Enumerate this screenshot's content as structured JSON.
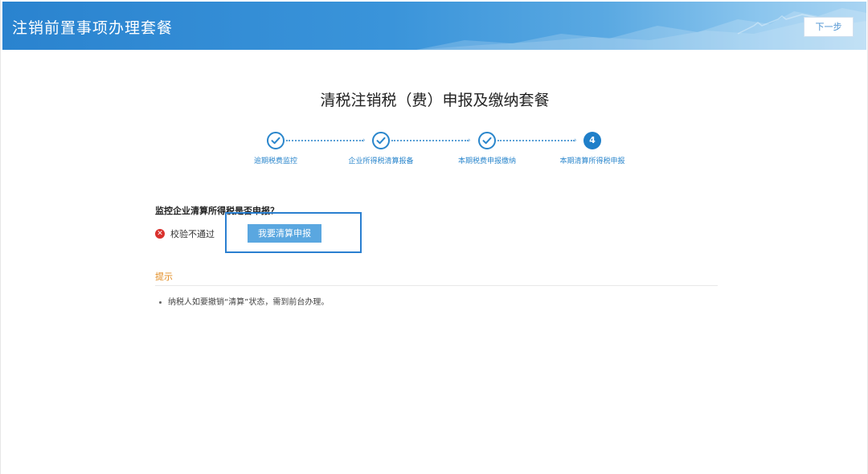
{
  "header": {
    "title": "注销前置事项办理套餐",
    "next_label": "下一步"
  },
  "main": {
    "title": "清税注销税（费）申报及缴纳套餐"
  },
  "steps": [
    {
      "label": "逾期税费监控",
      "status": "done"
    },
    {
      "label": "企业所得税清算报备",
      "status": "done"
    },
    {
      "label": "本期税费申报缴纳",
      "status": "done"
    },
    {
      "label": "本期清算所得税申报",
      "status": "current",
      "number": "4"
    }
  ],
  "question": {
    "text": "监控企业清算所得税是否申报？",
    "status_text": "校验不通过",
    "button_label": "我要清算申报"
  },
  "tips": {
    "title": "提示",
    "items": [
      "纳税人如要撤销“清算”状态，需到前台办理。"
    ]
  },
  "colors": {
    "primary": "#2a86cc",
    "button": "#5aa7e0",
    "error": "#d9302c",
    "tips_title": "#e28a1e"
  }
}
